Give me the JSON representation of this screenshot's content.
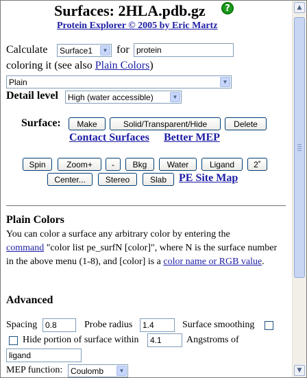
{
  "header": {
    "title": "Surfaces: 2HLA.pdb.gz",
    "subtitle": "Protein Explorer © 2005 by Eric Martz",
    "help_icon": "help-icon"
  },
  "calculate": {
    "label": "Calculate",
    "surface_select": "Surface1",
    "for_label": "for",
    "target_value": "protein",
    "coloring_label": "coloring it (see also",
    "plain_colors_link": "Plain Colors",
    "close_paren": ")",
    "coloring_select": "Plain",
    "detail_label": "Detail level",
    "detail_select": "High (water accessible)"
  },
  "surface_buttons": {
    "label": "Surface:",
    "make": "Make",
    "solid": "Solid/Transparent/Hide",
    "delete": "Delete",
    "contact_link": "Contact Surfaces",
    "mep_link": "Better MEP"
  },
  "view_buttons": {
    "spin": "Spin",
    "zoom": "Zoom+",
    "minus": "-",
    "bkg": "Bkg",
    "water": "Water",
    "ligand": "Ligand",
    "two_deg": "2˚",
    "center": "Center...",
    "stereo": "Stereo",
    "slab": "Slab",
    "site_map_link": "PE Site Map"
  },
  "plain_colors": {
    "heading": "Plain Colors",
    "text1": "You can color a surface any arbitrary color by entering the",
    "command_link": "command",
    "text2": " \"color list pe_surfN [color]\", where N is the surface number in the above menu (1-8), and [color] is a ",
    "color_link": "color name or RGB value",
    "text3": "."
  },
  "advanced": {
    "heading": "Advanced",
    "spacing_label": "Spacing",
    "spacing_value": "0.8",
    "probe_label": "Probe radius",
    "probe_value": "1.4",
    "smoothing_label": "Surface smoothing",
    "hide_label": "Hide portion of surface within",
    "hide_value": "4.1",
    "angstroms_label": "Angstroms of",
    "ligand_value": "ligand",
    "mep_label": "MEP function:",
    "mep_select": "Coulomb"
  },
  "colors": {
    "link": "#1c1ca5",
    "help_icon": "#1d9a1d",
    "button_border": "#003c74"
  }
}
